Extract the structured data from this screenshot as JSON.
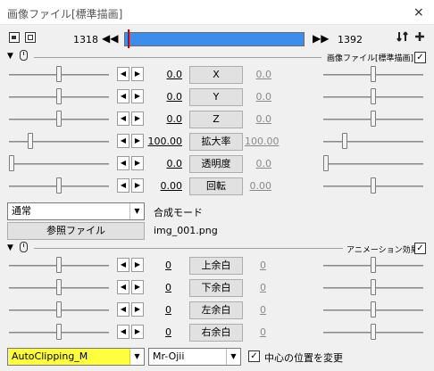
{
  "window": {
    "title": "画像ファイル[標準描画]",
    "close": "×"
  },
  "timeline": {
    "start": "1318",
    "end": "1392",
    "prev": "◀◀",
    "next": "▶▶"
  },
  "std_section": {
    "title": "画像ファイル[標準描画]",
    "checked": true,
    "rows": [
      {
        "name": "X",
        "value": "0.0",
        "value_right": "0.0",
        "level_left": 0.5,
        "level_right": 0.5
      },
      {
        "name": "Y",
        "value": "0.0",
        "value_right": "0.0",
        "level_left": 0.5,
        "level_right": 0.5
      },
      {
        "name": "Z",
        "value": "0.0",
        "value_right": "0.0",
        "level_left": 0.5,
        "level_right": 0.5
      },
      {
        "name": "拡大率",
        "value": "100.00",
        "value_right": "100.00",
        "level_left": 0.2,
        "level_right": 0.2
      },
      {
        "name": "透明度",
        "value": "0.0",
        "value_right": "0.0",
        "level_left": 0.0,
        "level_right": 0.0
      },
      {
        "name": "回転",
        "value": "0.00",
        "value_right": "0.00",
        "level_left": 0.5,
        "level_right": 0.5
      }
    ],
    "blend_mode": "通常",
    "blend_label": "合成モード",
    "ref_button": "参照ファイル",
    "filename": "img_001.png"
  },
  "anim_section": {
    "title": "アニメーション効果",
    "checked": true,
    "rows": [
      {
        "name": "上余白",
        "value": "0",
        "value_right": "0",
        "level_left": 0.5,
        "level_right": 0.5
      },
      {
        "name": "下余白",
        "value": "0",
        "value_right": "0",
        "level_left": 0.5,
        "level_right": 0.5
      },
      {
        "name": "左余白",
        "value": "0",
        "value_right": "0",
        "level_left": 0.5,
        "level_right": 0.5
      },
      {
        "name": "右余白",
        "value": "0",
        "value_right": "0",
        "level_left": 0.5,
        "level_right": 0.5
      }
    ],
    "script_select": "AutoClipping_M",
    "script_highlight": "#ffff40",
    "author_select": "Mr-Ojii",
    "center_checkbox_label": "中心の位置を変更",
    "center_checked": true
  },
  "colors": {
    "timeline_bar": "#3c8eea",
    "timeline_cursor": "#cc0000"
  },
  "glyphs": {
    "tri_down": "▼",
    "mouse": "⊕",
    "check": "✓",
    "left": "◀",
    "right": "▶",
    "drop": "▼"
  }
}
